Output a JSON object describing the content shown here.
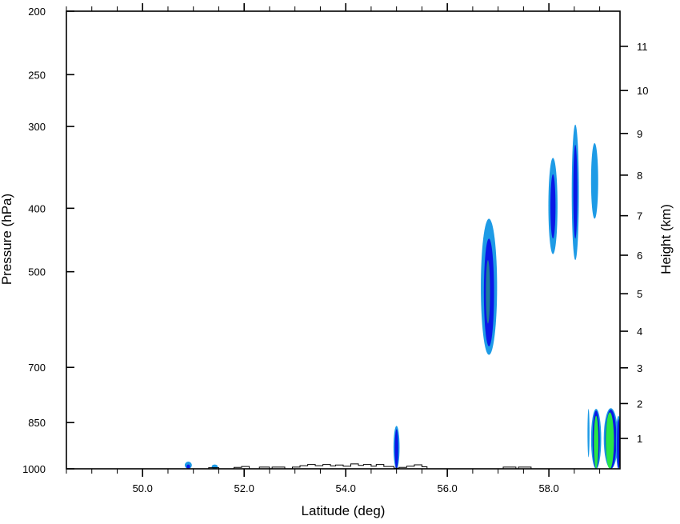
{
  "chart_data": {
    "type": "contour",
    "xlabel": "Latitude (deg)",
    "ylabel_left": "Pressure (hPa)",
    "ylabel_right": "Height (km)",
    "xlim": [
      48.5,
      59.4
    ],
    "x_ticks": [
      {
        "value": 50.0,
        "label": "50.0"
      },
      {
        "value": 52.0,
        "label": "52.0"
      },
      {
        "value": 54.0,
        "label": "54.0"
      },
      {
        "value": 56.0,
        "label": "56.0"
      },
      {
        "value": 58.0,
        "label": "58.0"
      }
    ],
    "y_scale": "log",
    "ylim": [
      1000,
      200
    ],
    "y_left_ticks": [
      {
        "value": 200,
        "label": "200"
      },
      {
        "value": 250,
        "label": "250"
      },
      {
        "value": 300,
        "label": "300"
      },
      {
        "value": 400,
        "label": "400"
      },
      {
        "value": 500,
        "label": "500"
      },
      {
        "value": 700,
        "label": "700"
      },
      {
        "value": 850,
        "label": "850"
      },
      {
        "value": 1000,
        "label": "1000"
      }
    ],
    "y_right_ticks": [
      {
        "value": 1,
        "label": "1"
      },
      {
        "value": 2,
        "label": "2"
      },
      {
        "value": 3,
        "label": "3"
      },
      {
        "value": 4,
        "label": "4"
      },
      {
        "value": 5,
        "label": "5"
      },
      {
        "value": 6,
        "label": "6"
      },
      {
        "value": 7,
        "label": "7"
      },
      {
        "value": 8,
        "label": "8"
      },
      {
        "value": 9,
        "label": "9"
      },
      {
        "value": 10,
        "label": "10"
      },
      {
        "value": 11,
        "label": "11"
      }
    ],
    "colors": {
      "light_blue": "#1e9be6",
      "dark_blue": "#0a18e6",
      "teal": "#1e7d9b",
      "green": "#28e646",
      "outline": "#000000"
    },
    "contours": [
      {
        "name": "blob-56.8",
        "layers": [
          {
            "level": "light",
            "lat_center": 56.82,
            "lat_halfwidth": 0.16,
            "p_top": 415,
            "p_bottom": 670
          },
          {
            "level": "dark",
            "lat_center": 56.82,
            "lat_halfwidth": 0.1,
            "p_top": 445,
            "p_bottom": 650
          },
          {
            "level": "teal",
            "lat_center": 56.8,
            "lat_halfwidth": 0.04,
            "p_top": 480,
            "p_bottom": 600
          }
        ]
      },
      {
        "name": "blob-58.1",
        "layers": [
          {
            "level": "light",
            "lat_center": 58.08,
            "lat_halfwidth": 0.09,
            "p_top": 335,
            "p_bottom": 470
          },
          {
            "level": "dark",
            "lat_center": 58.08,
            "lat_halfwidth": 0.05,
            "p_top": 355,
            "p_bottom": 445
          }
        ]
      },
      {
        "name": "blob-58.5",
        "layers": [
          {
            "level": "light",
            "lat_center": 58.52,
            "lat_halfwidth": 0.07,
            "p_top": 298,
            "p_bottom": 480
          },
          {
            "level": "dark",
            "lat_center": 58.52,
            "lat_halfwidth": 0.04,
            "p_top": 320,
            "p_bottom": 445
          }
        ]
      },
      {
        "name": "blob-58.9",
        "layers": [
          {
            "level": "light",
            "lat_center": 58.9,
            "lat_halfwidth": 0.07,
            "p_top": 318,
            "p_bottom": 415
          }
        ]
      },
      {
        "name": "blob-55.0",
        "layers": [
          {
            "level": "light",
            "lat_center": 55.0,
            "lat_halfwidth": 0.06,
            "p_top": 860,
            "p_bottom": 1000
          },
          {
            "level": "dark",
            "lat_center": 55.0,
            "lat_halfwidth": 0.035,
            "p_top": 870,
            "p_bottom": 1000
          }
        ]
      },
      {
        "name": "blob-50.9",
        "layers": [
          {
            "level": "light",
            "lat_center": 50.9,
            "lat_halfwidth": 0.07,
            "p_top": 975,
            "p_bottom": 1000
          },
          {
            "level": "dark",
            "lat_center": 50.9,
            "lat_halfwidth": 0.035,
            "p_top": 985,
            "p_bottom": 1000
          }
        ]
      },
      {
        "name": "blob-51.4",
        "layers": [
          {
            "level": "light",
            "lat_center": 51.42,
            "lat_halfwidth": 0.06,
            "p_top": 985,
            "p_bottom": 1000
          }
        ]
      },
      {
        "name": "blob-58.8",
        "layers": [
          {
            "level": "light",
            "lat_center": 58.78,
            "lat_halfwidth": 0.02,
            "p_top": 810,
            "p_bottom": 960
          }
        ]
      },
      {
        "name": "blob-58.9-low",
        "layers": [
          {
            "level": "light",
            "lat_center": 58.93,
            "lat_halfwidth": 0.1,
            "p_top": 810,
            "p_bottom": 1000
          },
          {
            "level": "dark",
            "lat_center": 58.93,
            "lat_halfwidth": 0.07,
            "p_top": 815,
            "p_bottom": 1000
          },
          {
            "level": "green",
            "lat_center": 58.93,
            "lat_halfwidth": 0.045,
            "p_top": 830,
            "p_bottom": 1000
          }
        ]
      },
      {
        "name": "blob-59.2-low",
        "layers": [
          {
            "level": "light",
            "lat_center": 59.22,
            "lat_halfwidth": 0.14,
            "p_top": 808,
            "p_bottom": 1000
          },
          {
            "level": "dark",
            "lat_center": 59.22,
            "lat_halfwidth": 0.11,
            "p_top": 812,
            "p_bottom": 1000
          },
          {
            "level": "green",
            "lat_center": 59.2,
            "lat_halfwidth": 0.08,
            "p_top": 820,
            "p_bottom": 1000
          }
        ]
      },
      {
        "name": "blob-59.35-low",
        "layers": [
          {
            "level": "light",
            "lat_center": 59.37,
            "lat_halfwidth": 0.05,
            "p_top": 830,
            "p_bottom": 1000
          },
          {
            "level": "dark",
            "lat_center": 59.37,
            "lat_halfwidth": 0.03,
            "p_top": 840,
            "p_bottom": 1000
          }
        ]
      }
    ],
    "terrain": [
      [
        48.5,
        1000
      ],
      [
        51.3,
        1000
      ],
      [
        51.3,
        996
      ],
      [
        51.5,
        996
      ],
      [
        51.5,
        1000
      ],
      [
        51.8,
        1000
      ],
      [
        51.8,
        995
      ],
      [
        51.95,
        995
      ],
      [
        51.95,
        992
      ],
      [
        52.1,
        992
      ],
      [
        52.1,
        1000
      ],
      [
        52.3,
        1000
      ],
      [
        52.3,
        994
      ],
      [
        52.5,
        994
      ],
      [
        52.5,
        1000
      ],
      [
        52.55,
        1000
      ],
      [
        52.55,
        994
      ],
      [
        52.8,
        994
      ],
      [
        52.8,
        1000
      ],
      [
        52.95,
        1000
      ],
      [
        52.95,
        994
      ],
      [
        53.1,
        994
      ],
      [
        53.1,
        989
      ],
      [
        53.25,
        989
      ],
      [
        53.25,
        985
      ],
      [
        53.4,
        985
      ],
      [
        53.4,
        989
      ],
      [
        53.55,
        989
      ],
      [
        53.55,
        985
      ],
      [
        53.7,
        985
      ],
      [
        53.7,
        990
      ],
      [
        53.8,
        990
      ],
      [
        53.8,
        987
      ],
      [
        53.95,
        987
      ],
      [
        53.95,
        991
      ],
      [
        54.1,
        991
      ],
      [
        54.1,
        983
      ],
      [
        54.25,
        983
      ],
      [
        54.25,
        988
      ],
      [
        54.35,
        988
      ],
      [
        54.35,
        985
      ],
      [
        54.5,
        985
      ],
      [
        54.5,
        991
      ],
      [
        54.6,
        991
      ],
      [
        54.6,
        985
      ],
      [
        54.75,
        985
      ],
      [
        54.75,
        992
      ],
      [
        54.95,
        992
      ],
      [
        54.95,
        998
      ],
      [
        55.05,
        998
      ],
      [
        55.05,
        995
      ],
      [
        55.2,
        995
      ],
      [
        55.2,
        991
      ],
      [
        55.35,
        991
      ],
      [
        55.35,
        986
      ],
      [
        55.5,
        986
      ],
      [
        55.5,
        993
      ],
      [
        55.6,
        993
      ],
      [
        55.6,
        1000
      ],
      [
        57.1,
        1000
      ],
      [
        57.1,
        994
      ],
      [
        57.35,
        994
      ],
      [
        57.35,
        1000
      ],
      [
        57.4,
        1000
      ],
      [
        57.4,
        994
      ],
      [
        57.65,
        994
      ],
      [
        57.65,
        1000
      ],
      [
        59.4,
        1000
      ]
    ]
  }
}
